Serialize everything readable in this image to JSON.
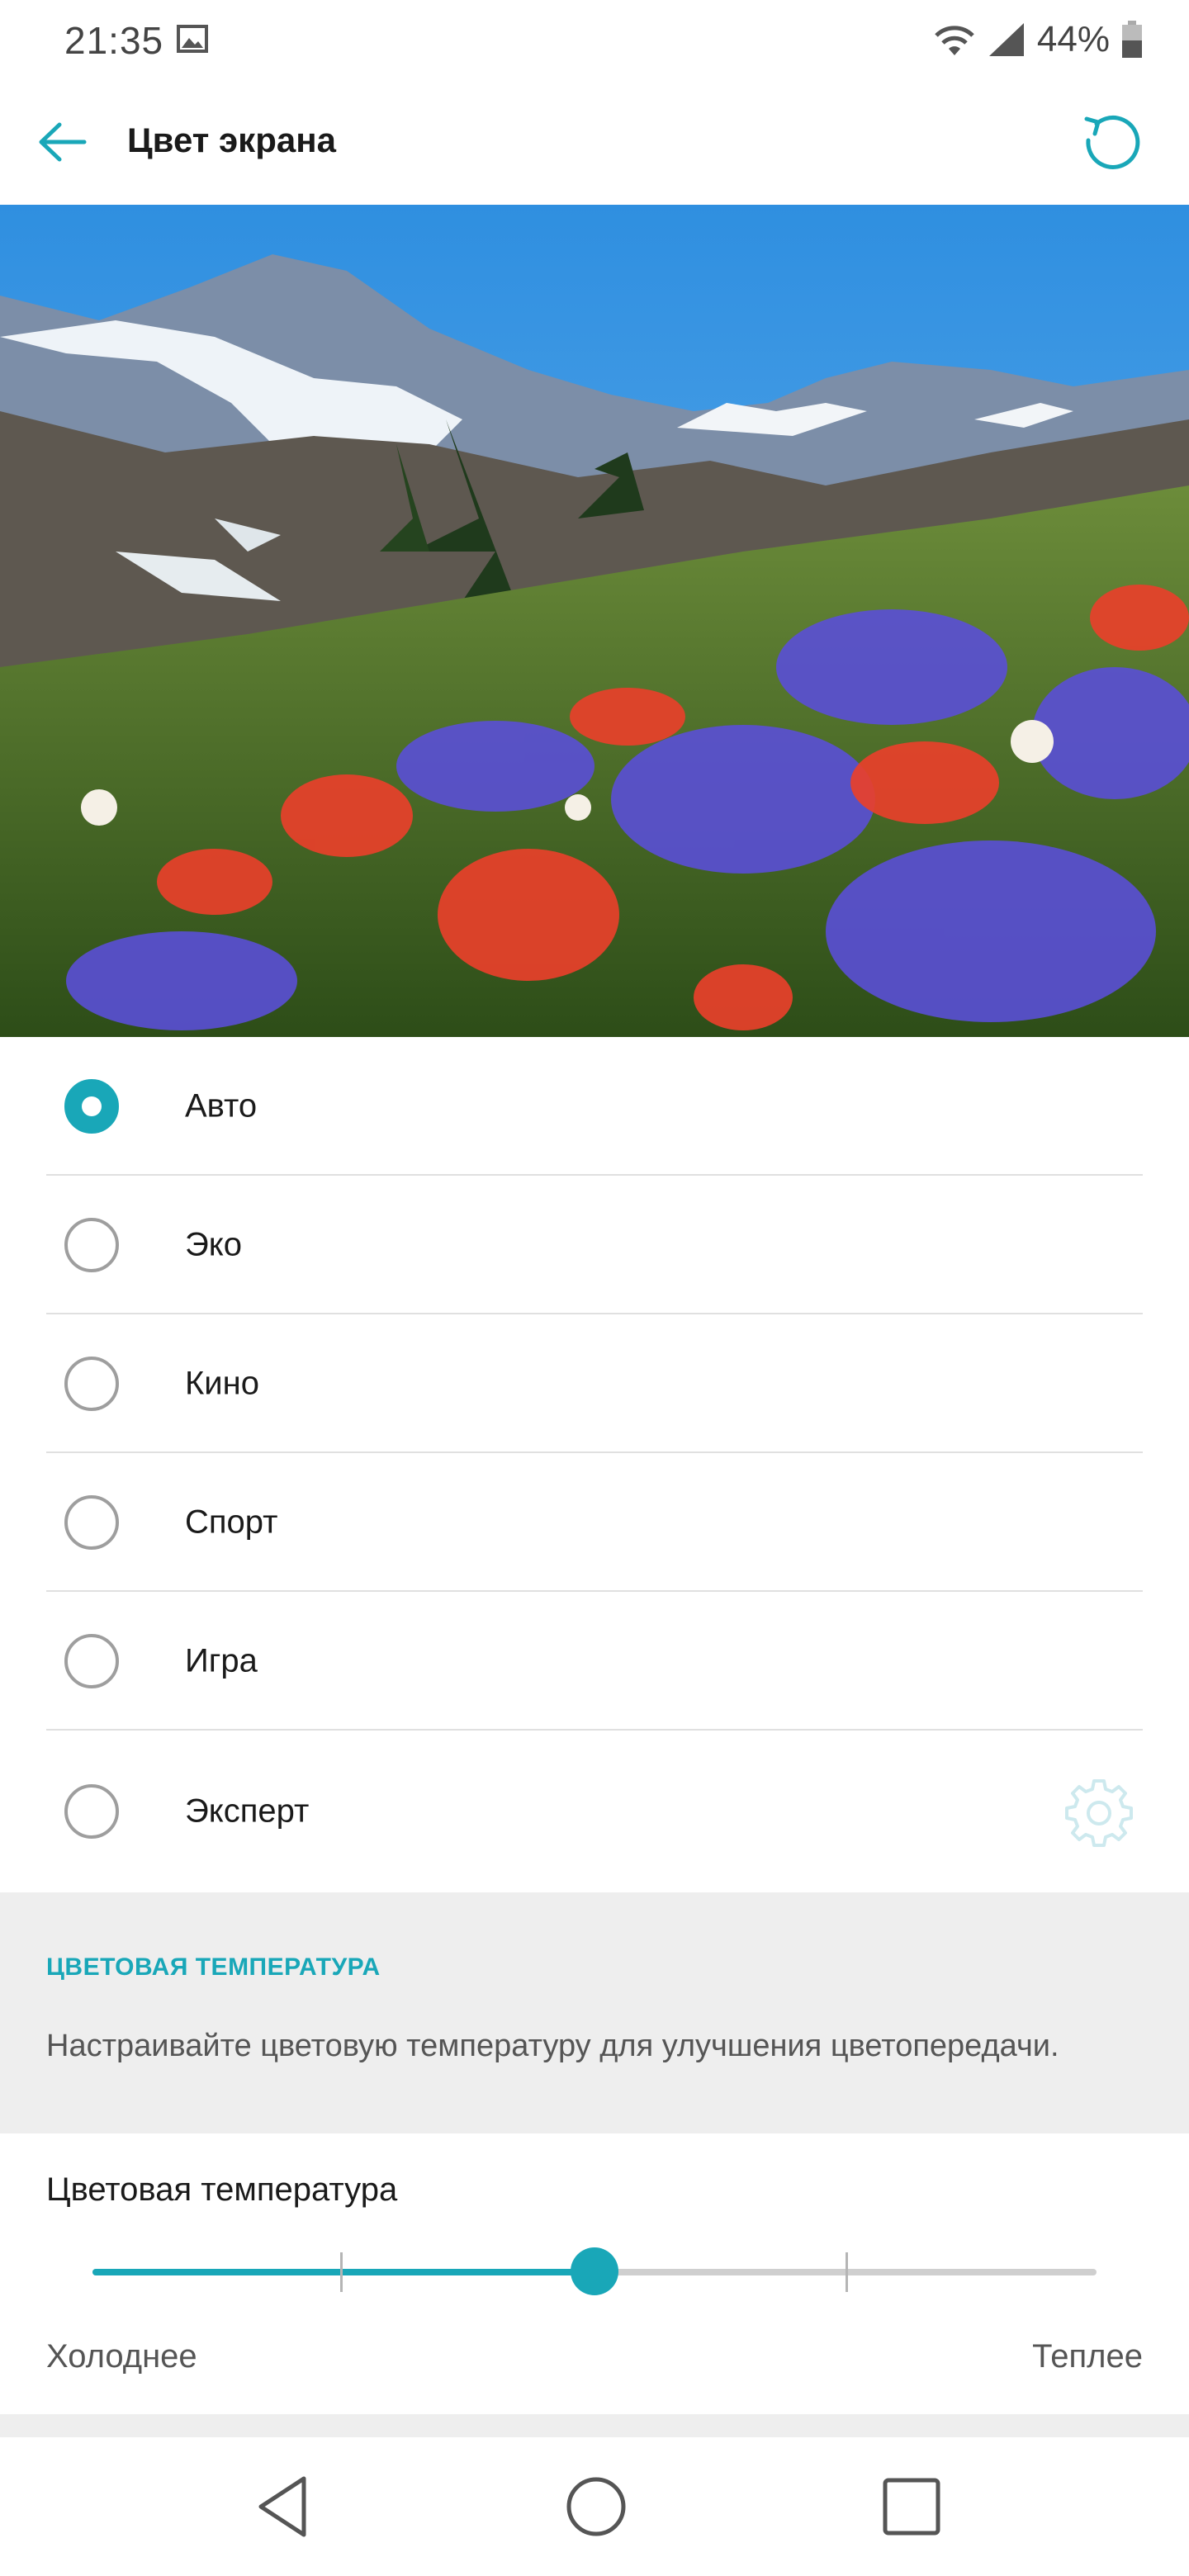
{
  "status_bar": {
    "time": "21:35",
    "battery": "44%",
    "icons": [
      "image-icon",
      "wifi-icon",
      "signal-icon",
      "battery-icon"
    ]
  },
  "app_bar": {
    "title": "Цвет экрана",
    "back_icon": "arrow-left-icon",
    "reset_icon": "refresh-icon"
  },
  "preview": {
    "description_icon": "landscape-preview"
  },
  "modes": [
    {
      "label": "Авто",
      "checked": true
    },
    {
      "label": "Эко",
      "checked": false
    },
    {
      "label": "Кино",
      "checked": false
    },
    {
      "label": "Спорт",
      "checked": false
    },
    {
      "label": "Игра",
      "checked": false
    },
    {
      "label": "Эксперт",
      "checked": false
    }
  ],
  "section": {
    "header": "ЦВЕТОВАЯ ТЕМПЕРАТУРА",
    "description": "Настраивайте цветовую температуру для улучшения цветопередачи."
  },
  "temperature": {
    "title": "Цветовая температура",
    "min_label": "Холоднее",
    "max_label": "Теплее",
    "value_fraction": 0.5
  },
  "colors": {
    "accent": "#19a7b8"
  }
}
